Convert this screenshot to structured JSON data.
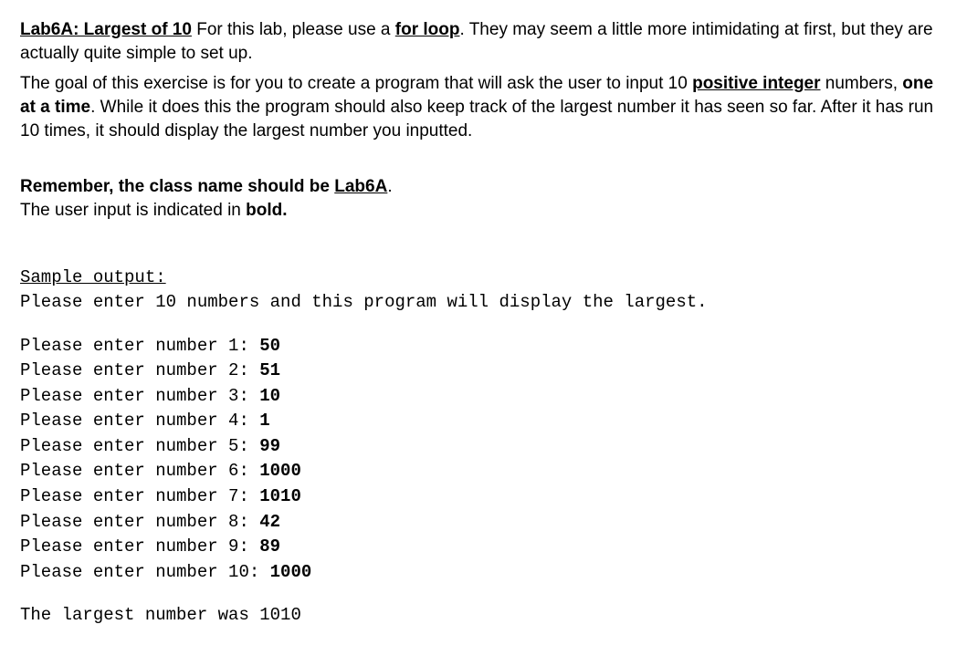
{
  "title_label": "Lab6A: Largest of 10",
  "intro_1a": " For this lab, please use a ",
  "for_loop": "for loop",
  "intro_1b": ". They may seem a little more intimidating at first, but they are actually quite simple to set up.",
  "intro_2a": "The goal of this exercise is for you to create a program that will ask the user to input 10 ",
  "positive_integer": "positive integer",
  "intro_2b": " numbers, ",
  "one_at_a_time": "one at a time",
  "intro_2c": ". While it does this the program should also keep track of the largest number it has seen so far. After it has run 10 times, it should display the largest number you inputted.",
  "remember_a": "Remember, the class name should be ",
  "lab6a": "Lab6A",
  "remember_b": ".",
  "user_input_a": "The user input is indicated in ",
  "bold_word": "bold.",
  "sample_output_label": "Sample output:",
  "sample_intro": "Please enter 10 numbers and this program will display the largest.",
  "entries": [
    {
      "prompt": "Please enter number 1: ",
      "value": "50"
    },
    {
      "prompt": "Please enter number 2: ",
      "value": "51"
    },
    {
      "prompt": "Please enter number 3: ",
      "value": "10"
    },
    {
      "prompt": "Please enter number 4: ",
      "value": "1"
    },
    {
      "prompt": "Please enter number 5: ",
      "value": "99"
    },
    {
      "prompt": "Please enter number 6: ",
      "value": "1000"
    },
    {
      "prompt": "Please enter number 7: ",
      "value": "1010"
    },
    {
      "prompt": "Please enter number 8: ",
      "value": "42"
    },
    {
      "prompt": "Please enter number 9: ",
      "value": "89"
    },
    {
      "prompt": "Please enter number 10: ",
      "value": "1000"
    }
  ],
  "result_line": "The largest number was 1010"
}
